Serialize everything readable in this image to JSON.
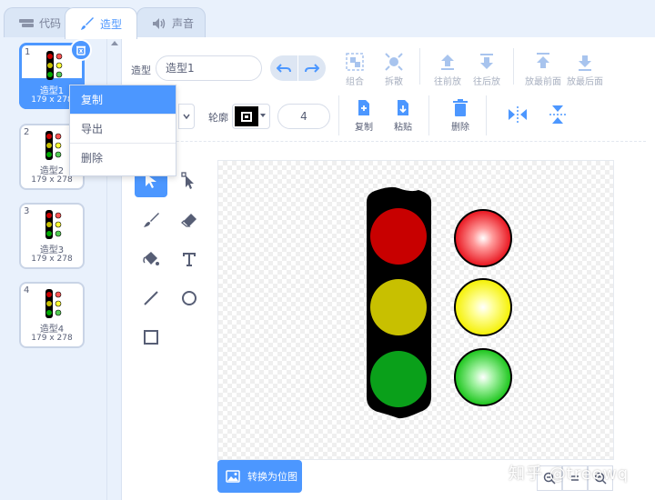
{
  "tabs": [
    {
      "label": "代码",
      "icon": "code-icon"
    },
    {
      "label": "造型",
      "icon": "brush-icon",
      "active": true
    },
    {
      "label": "声音",
      "icon": "speaker-icon"
    }
  ],
  "costumes": [
    {
      "number": "1",
      "name": "造型1",
      "size": "179 x 278",
      "selected": true
    },
    {
      "number": "2",
      "name": "造型2",
      "size": "179 x 278"
    },
    {
      "number": "3",
      "name": "造型3",
      "size": "179 x 278"
    },
    {
      "number": "4",
      "name": "造型4",
      "size": "179 x 278"
    }
  ],
  "context_menu": [
    "复制",
    "导出",
    "删除"
  ],
  "editor": {
    "costume_label": "造型",
    "costume_name": "造型1",
    "arrange": [
      "组合",
      "拆散",
      "往前放",
      "往后放",
      "放最前面",
      "放最后面"
    ],
    "outline_label": "轮廓",
    "outline_color": "#000000",
    "outline_width": "4",
    "edit_buttons": [
      "复制",
      "粘贴",
      "删除"
    ],
    "convert_button": "转换为位图",
    "accent_color": "#4c97ff"
  },
  "watermark": "知乎 @treewq"
}
